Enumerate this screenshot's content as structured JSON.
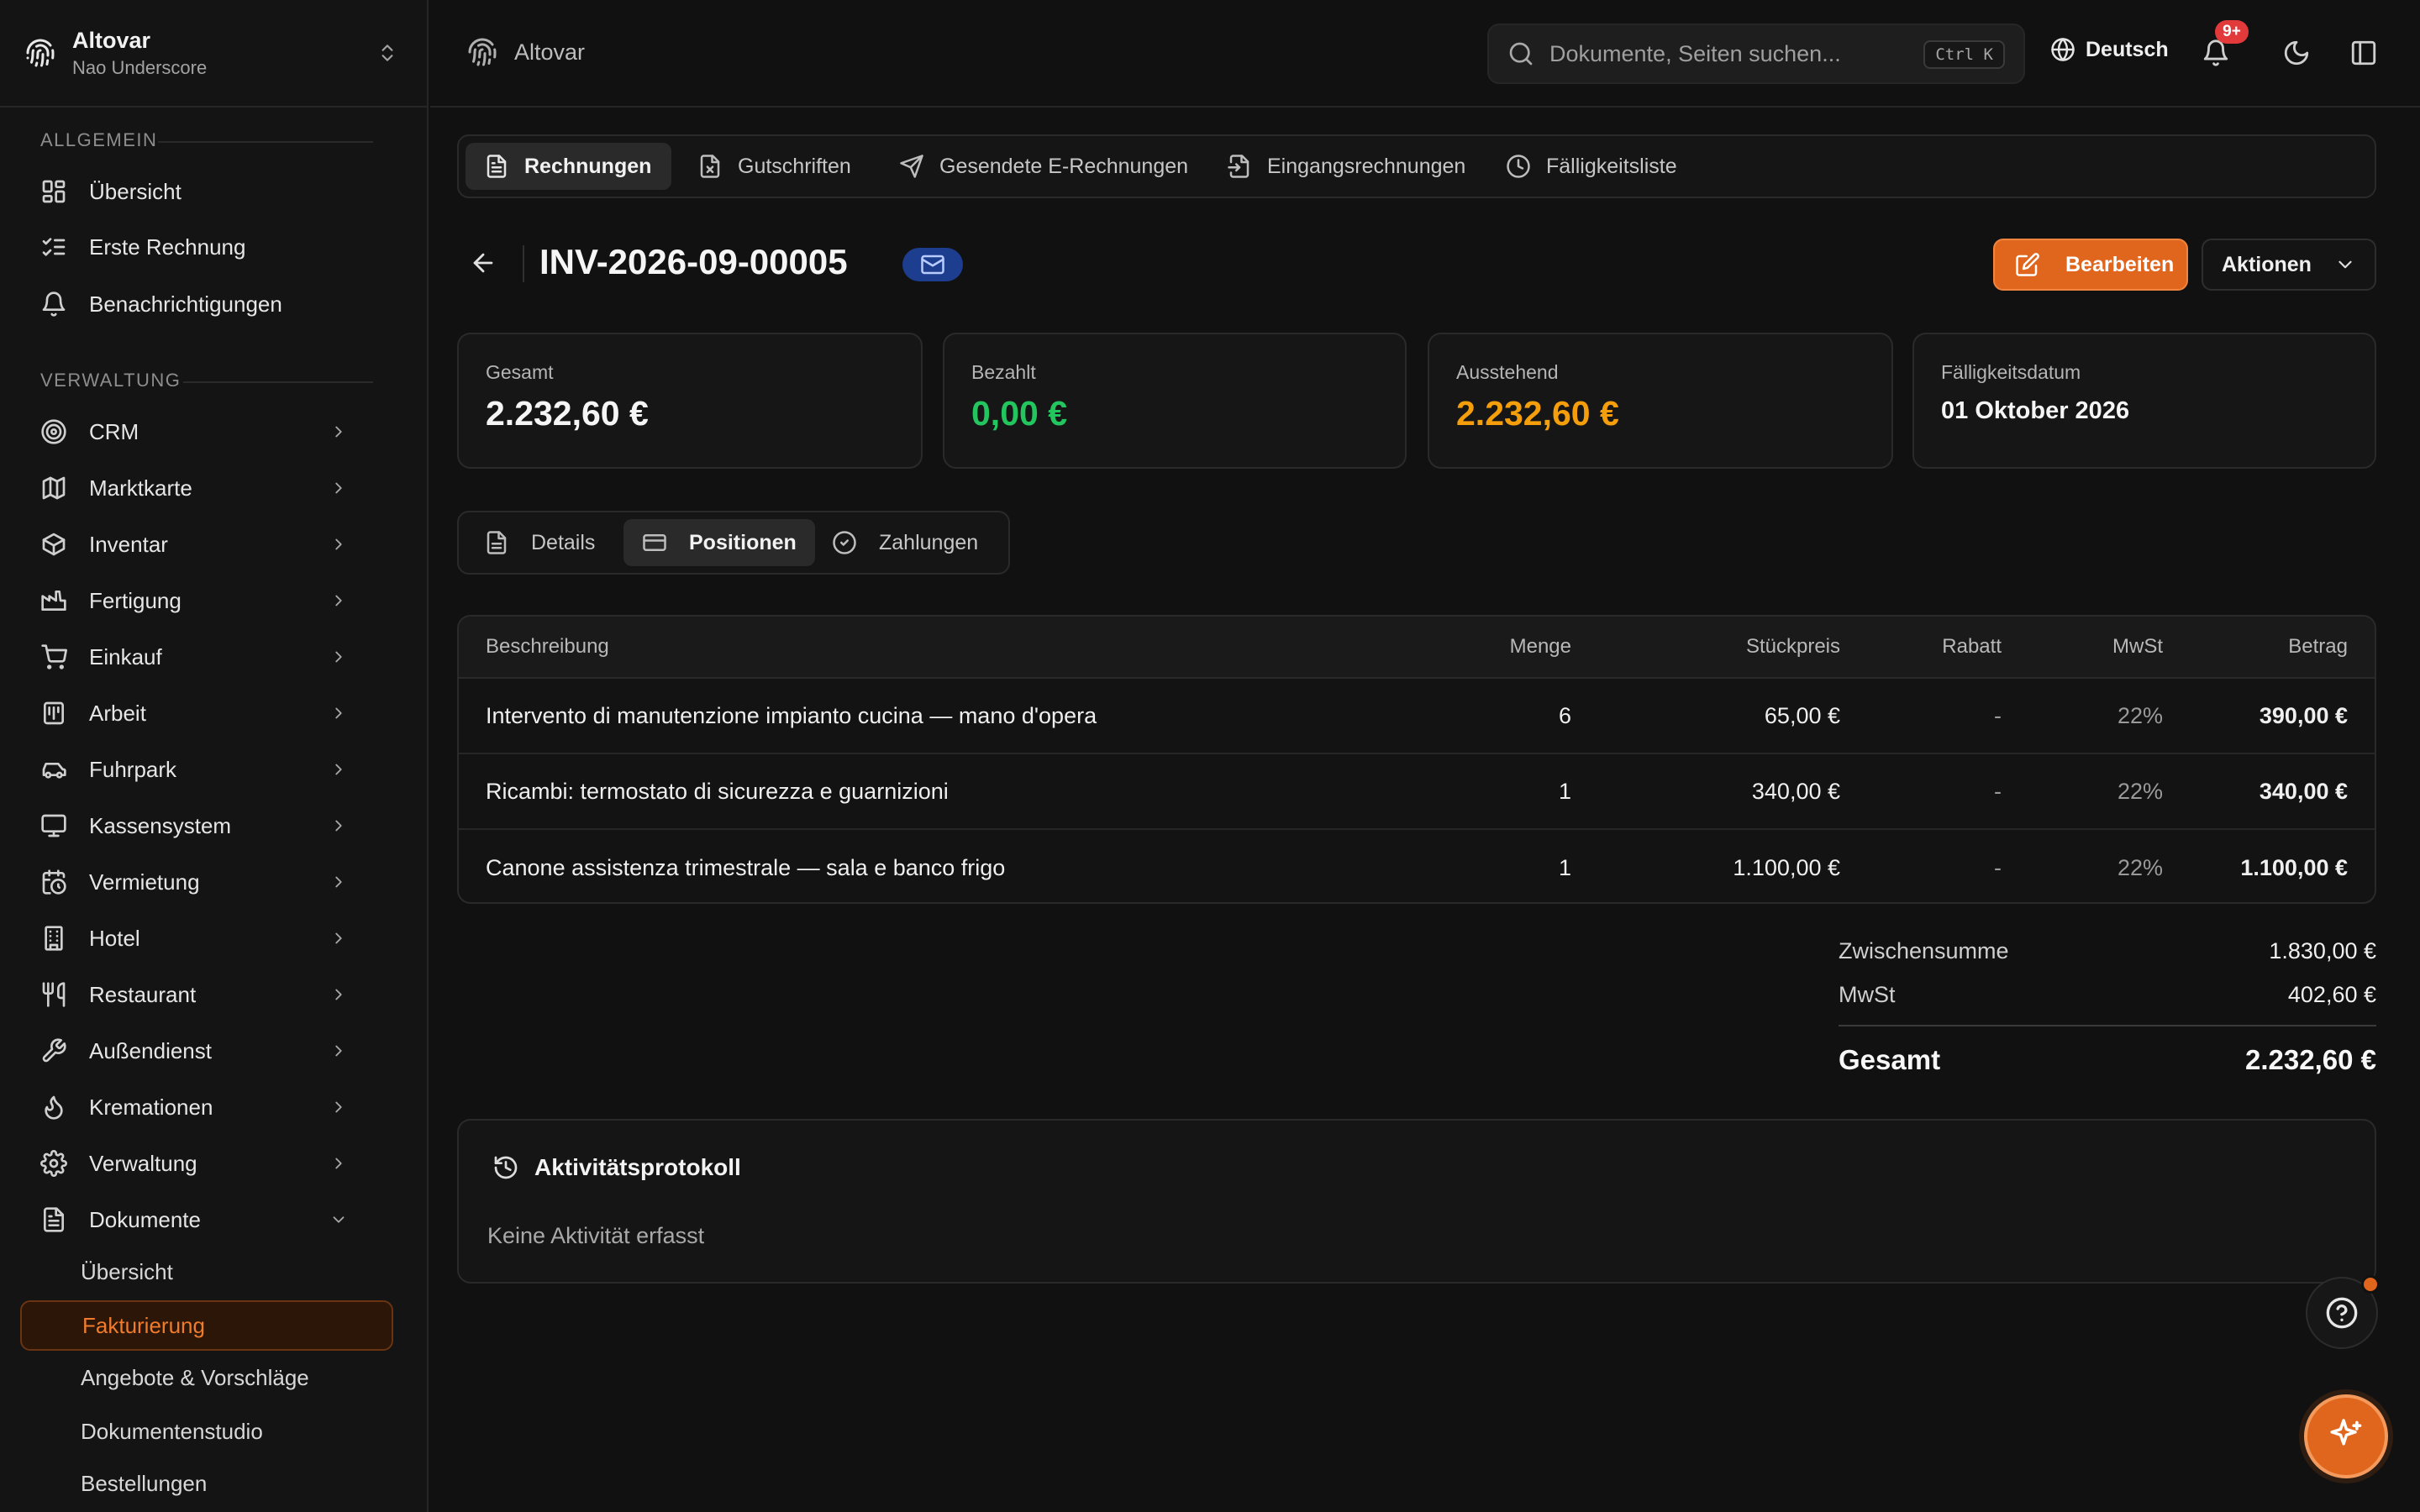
{
  "brand": {
    "name": "Altovar",
    "user": "Nao Underscore"
  },
  "sidebar": {
    "section_general": "ALLGEMEIN",
    "general": [
      {
        "label": "Übersicht",
        "icon": "dashboard-icon"
      },
      {
        "label": "Erste Rechnung",
        "icon": "list-checks-icon"
      },
      {
        "label": "Benachrichtigungen",
        "icon": "bell-icon"
      }
    ],
    "section_admin": "VERWALTUNG",
    "admin": [
      {
        "label": "CRM",
        "icon": "target-icon"
      },
      {
        "label": "Marktkarte",
        "icon": "map-icon"
      },
      {
        "label": "Inventar",
        "icon": "box-icon"
      },
      {
        "label": "Fertigung",
        "icon": "factory-icon"
      },
      {
        "label": "Einkauf",
        "icon": "cart-icon"
      },
      {
        "label": "Arbeit",
        "icon": "clipboard-icon"
      },
      {
        "label": "Fuhrpark",
        "icon": "car-icon"
      },
      {
        "label": "Kassensystem",
        "icon": "monitor-icon"
      },
      {
        "label": "Vermietung",
        "icon": "calendar-clock-icon"
      },
      {
        "label": "Hotel",
        "icon": "building-icon"
      },
      {
        "label": "Restaurant",
        "icon": "utensils-icon"
      },
      {
        "label": "Außendienst",
        "icon": "wrench-icon"
      },
      {
        "label": "Kremationen",
        "icon": "flame-icon"
      },
      {
        "label": "Verwaltung",
        "icon": "settings-icon"
      },
      {
        "label": "Dokumente",
        "icon": "file-icon"
      }
    ],
    "documents_sub": [
      "Übersicht",
      "Fakturierung",
      "Angebote & Vorschläge",
      "Dokumentenstudio",
      "Bestellungen"
    ],
    "active_sub": "Fakturierung"
  },
  "topbar": {
    "crumb": "Altovar",
    "search_placeholder": "Dokumente, Seiten suchen...",
    "shortcut": "Ctrl K",
    "language": "Deutsch",
    "notification_count": "9+"
  },
  "doc_tabs": [
    {
      "label": "Rechnungen",
      "icon": "file-text-icon",
      "active": true
    },
    {
      "label": "Gutschriften",
      "icon": "file-x-icon",
      "active": false
    },
    {
      "label": "Gesendete E-Rechnungen",
      "icon": "send-icon",
      "active": false
    },
    {
      "label": "Eingangsrechnungen",
      "icon": "file-import-icon",
      "active": false
    },
    {
      "label": "Fälligkeitsliste",
      "icon": "clock-icon",
      "active": false
    }
  ],
  "invoice": {
    "number": "INV-2026-09-00005",
    "edit_label": "Bearbeiten",
    "actions_label": "Aktionen"
  },
  "summary": {
    "total_label": "Gesamt",
    "total": "2.232,60 €",
    "paid_label": "Bezahlt",
    "paid": "0,00 €",
    "open_label": "Ausstehend",
    "open": "2.232,60 €",
    "due_label": "Fälligkeitsdatum",
    "due": "01 Oktober 2026"
  },
  "detail_tabs": [
    {
      "label": "Details",
      "icon": "file-icon",
      "active": false
    },
    {
      "label": "Positionen",
      "icon": "credit-card-icon",
      "active": true
    },
    {
      "label": "Zahlungen",
      "icon": "check-circle-icon",
      "active": false
    }
  ],
  "table": {
    "headers": {
      "desc": "Beschreibung",
      "qty": "Menge",
      "price": "Stückpreis",
      "discount": "Rabatt",
      "vat": "MwSt",
      "amount": "Betrag"
    },
    "rows": [
      {
        "desc": "Intervento di manutenzione impianto cucina — mano d'opera",
        "qty": "6",
        "price": "65,00 €",
        "discount": "-",
        "vat": "22%",
        "amount": "390,00 €"
      },
      {
        "desc": "Ricambi: termostato di sicurezza e guarnizioni",
        "qty": "1",
        "price": "340,00 €",
        "discount": "-",
        "vat": "22%",
        "amount": "340,00 €"
      },
      {
        "desc": "Canone assistenza trimestrale — sala e banco frigo",
        "qty": "1",
        "price": "1.100,00 €",
        "discount": "-",
        "vat": "22%",
        "amount": "1.100,00 €"
      }
    ]
  },
  "totals": {
    "subtotal_label": "Zwischensumme",
    "subtotal": "1.830,00 €",
    "vat_label": "MwSt",
    "vat": "402,60 €",
    "grand_label": "Gesamt",
    "grand": "2.232,60 €"
  },
  "activity": {
    "title": "Aktivitätsprotokoll",
    "empty": "Keine Aktivität erfasst"
  },
  "colors": {
    "accent": "#e0651d",
    "paid": "#22c55e",
    "open": "#f59e0b",
    "badge": "#e23a3a",
    "mail": "#1d3d8f"
  }
}
